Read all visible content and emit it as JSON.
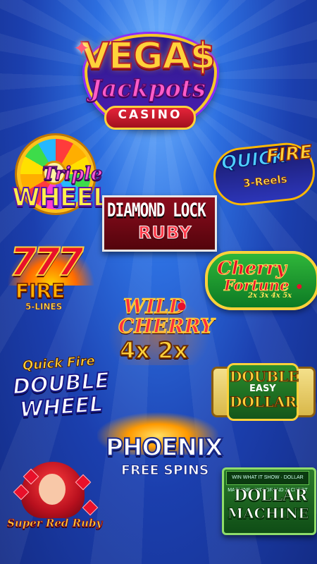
{
  "vegas": {
    "line1": "VEGA$",
    "line2": "Jackpots",
    "line3": "CASINO"
  },
  "games": {
    "triple_wheel": {
      "line1": "Triple",
      "line2": "WHEEL"
    },
    "quick_fire": {
      "line1": "QUICK",
      "line2": "FIRE",
      "line3": "3-Reels"
    },
    "diamond_lock": {
      "line1": "DIAMOND LOCK",
      "line2": "RUBY"
    },
    "fire_777": {
      "line1": "777",
      "line2": "FIRE",
      "line3": "5-LINES"
    },
    "cherry_fortune": {
      "line1": "Cherry",
      "line2": "Fortune",
      "line3": "2x 3x 4x 5x"
    },
    "wild_cherry": {
      "line1": "WILD",
      "line2": "CHERRY",
      "line3": "4x 2x"
    },
    "double_wheel": {
      "line1": "Quick Fire",
      "line2": "DOUBLE",
      "line3": "WHEEL"
    },
    "double_easy_dollar": {
      "line1": "DOUBLE",
      "line2": "EASY",
      "line3": "DOLLAR"
    },
    "phoenix": {
      "line1": "PHOENIX",
      "line2": "FREE SPINS"
    },
    "super_red_ruby": {
      "line1": "Super Red Ruby"
    },
    "dollar_machine": {
      "top": "WIN WHAT IT SHOW · DOLLAR MACHINE · WIN GRAND JACKPOT",
      "line1": "DOLLAR",
      "line2": "MACHINE"
    }
  }
}
